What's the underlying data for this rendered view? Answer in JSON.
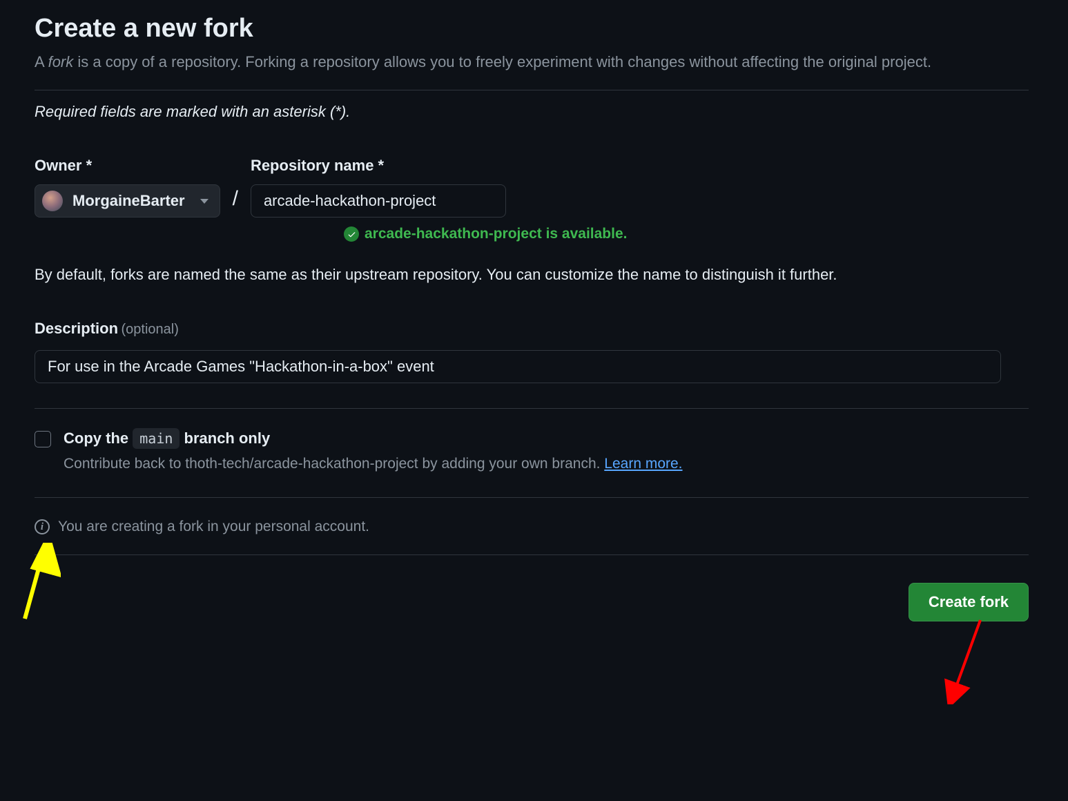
{
  "header": {
    "title": "Create a new fork",
    "subtitle_prefix": "A ",
    "subtitle_em": "fork",
    "subtitle_rest": " is a copy of a repository. Forking a repository allows you to freely experiment with changes without affecting the original project.",
    "required_note": "Required fields are marked with an asterisk (*)."
  },
  "owner": {
    "label": "Owner *",
    "name": "MorgaineBarter"
  },
  "repo": {
    "label": "Repository name *",
    "value": "arcade-hackathon-project",
    "availability": "arcade-hackathon-project is available."
  },
  "help": {
    "naming": "By default, forks are named the same as their upstream repository. You can customize the name to distinguish it further."
  },
  "description": {
    "label": "Description",
    "optional": "(optional)",
    "value": "For use in the Arcade Games \"Hackathon-in-a-box\" event"
  },
  "copy_branch": {
    "title_prefix": "Copy the ",
    "branch": "main",
    "title_suffix": " branch only",
    "subtitle": "Contribute back to thoth-tech/arcade-hackathon-project by adding your own branch. ",
    "link": "Learn more."
  },
  "info": {
    "text": "You are creating a fork in your personal account."
  },
  "actions": {
    "create": "Create fork"
  }
}
